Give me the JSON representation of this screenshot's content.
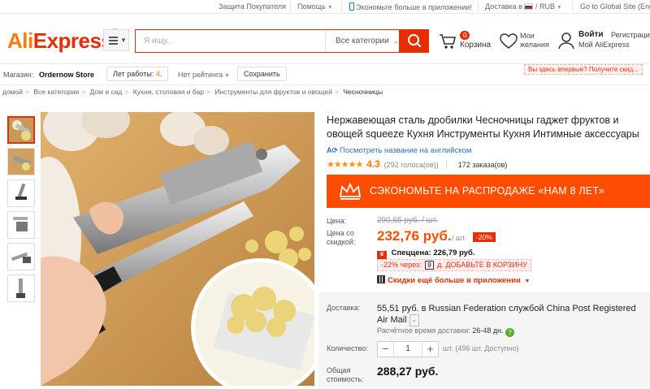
{
  "topbar": {
    "buyer_protection": "Защита Покупателя",
    "help": "Помощь",
    "app_promo": "Экономьте больше в приложении!",
    "delivery": "Доставка в",
    "currency": "RUB",
    "global_site": "Go to Global Site (English)"
  },
  "header": {
    "logo_a": "Ali",
    "logo_b": "Express",
    "search_placeholder": "Я ищу...",
    "search_category": "Все категории",
    "cart_count": "0",
    "cart_label": "Корзина",
    "wishlist_line1": "Мои",
    "wishlist_line2": "желания",
    "login": "Войти",
    "register": "Регистрация",
    "my_aliexpress": "Мой AliExpress",
    "first_time": "Вы здесь впервые? Получите скид..."
  },
  "store": {
    "label": "Магазин:",
    "name": "Ordernow Store",
    "years_label": "Лет работы:",
    "years_value": "4",
    "rating": "Нет рейтинга",
    "save": "Сохранить"
  },
  "breadcrumbs": [
    "домой",
    "Все категории",
    "Дом и сад",
    "Кухня, столовая и бар",
    "Инструменты для фруктов и овощей",
    "Чесночницы"
  ],
  "product": {
    "title": "Нержавеющая сталь дробилки Чесночницы гаджет фруктов и овощей squeeze Кухня Инструменты Кухня Интимные аксессуары",
    "translate": "Посмотреть название на английском",
    "stars": "★★★★★",
    "rating": "4.3",
    "votes": "(292 голоса(ов))",
    "orders": "172 заказа(ов)",
    "banner": "СЭКОНОМЬТЕ НА РАСПРОДАЖЕ «НАМ 8 ЛЕТ»",
    "price_label": "Цена:",
    "old_price": "290,65 руб. / шт.",
    "discount_label_1": "Цена со",
    "discount_label_2": "скидкой:",
    "price": "232,76 руб.",
    "per_unit": "/ шт.",
    "discount": "-20%",
    "special_label": "Спеццена:",
    "special_price": "226,79 руб.",
    "coupon_pct": "-22%",
    "coupon_via": "через:",
    "coupon_days": "9",
    "coupon_add": "д. ДОБАВЬТЕ В КОРЗИНУ",
    "app_more": "Скидки ещё больше в приложении",
    "delivery_label": "Доставка:",
    "delivery_text": "55,51 руб. в Russian Federation службой China Post Registered Air Mail",
    "eta_label": "Расчётное время доставки:",
    "eta_value": "26-48 дн.",
    "qty_label": "Количество:",
    "qty_value": "1",
    "availability": "шт. (496 шт. Доступно)",
    "total_label_1": "Общая",
    "total_label_2": "стоимость:",
    "total": "288,27 руб."
  },
  "colors": {
    "accent": "#e62e04",
    "orange": "#ff4d00",
    "link": "#2b6cc4"
  }
}
